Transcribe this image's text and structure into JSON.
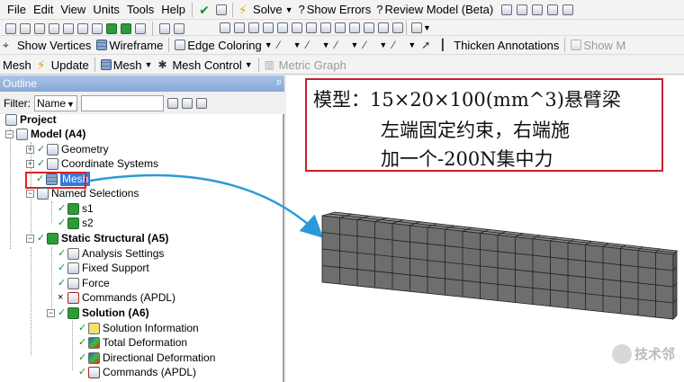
{
  "menubar": {
    "items": [
      "File",
      "Edit",
      "View",
      "Units",
      "Tools",
      "Help"
    ],
    "solve_label": "Solve",
    "show_errors_label": "Show Errors",
    "review_model_label": "Review Model (Beta)"
  },
  "toolbar2": {
    "show_vertices": "Show Vertices",
    "wireframe": "Wireframe",
    "edge_coloring": "Edge Coloring",
    "thicken_annotations": "Thicken Annotations",
    "show_m": "Show M"
  },
  "toolbar3": {
    "mesh_label": "Mesh",
    "update_label": "Update",
    "mesh_menu": "Mesh",
    "mesh_control": "Mesh Control",
    "metric_graph": "Metric Graph"
  },
  "outline": {
    "title": "Outline",
    "pin": "ᵖ",
    "filter_label": "Filter:",
    "filter_value": "Name",
    "tree": {
      "project": "Project",
      "model": "Model (A4)",
      "geometry": "Geometry",
      "coordinate_systems": "Coordinate Systems",
      "mesh": "Mesh",
      "named_selections": "Named Selections",
      "s1": "s1",
      "s2": "s2",
      "static_structural": "Static Structural (A5)",
      "analysis_settings": "Analysis Settings",
      "fixed_support": "Fixed Support",
      "force": "Force",
      "commands_1": "Commands (APDL)",
      "solution": "Solution (A6)",
      "solution_information": "Solution Information",
      "total_deformation": "Total Deformation",
      "directional_deformation": "Directional Deformation",
      "commands_2": "Commands (APDL)"
    }
  },
  "annotation": {
    "line1": "模型：15×20×100(mm^3)悬臂梁",
    "line2": "左端固定约束，右端施",
    "line3": "加一个-200N集中力"
  },
  "watermark": "技术邻",
  "colors": {
    "highlight_red": "#e02020",
    "arrow_blue": "#2a9ad8",
    "mesh_gray": "#6e6e6e",
    "outline_header": "#86a8d6"
  }
}
